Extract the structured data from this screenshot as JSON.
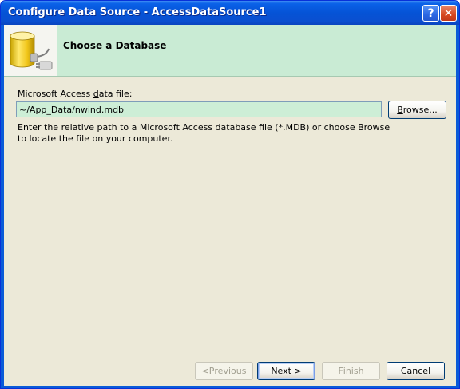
{
  "window": {
    "title": "Configure Data Source - AccessDataSource1",
    "help_glyph": "?",
    "close_glyph": "✕"
  },
  "header": {
    "title": "Choose a Database",
    "icon": "database-plug-icon"
  },
  "file": {
    "label_before": "Microsoft Access ",
    "label_mnemonic": "d",
    "label_after": "ata file:",
    "value": "~/App_Data/nwind.mdb",
    "browse_before": "",
    "browse_mnemonic": "B",
    "browse_after": "rowse..."
  },
  "help_text": "Enter the relative path to a Microsoft Access database file (*.MDB) or choose Browse to locate the file on your computer.",
  "buttons": {
    "previous_before": "< ",
    "previous_mnemonic": "P",
    "previous_after": "revious",
    "next_before": "",
    "next_mnemonic": "N",
    "next_after": "ext >",
    "finish_before": "",
    "finish_mnemonic": "F",
    "finish_after": "inish",
    "cancel": "Cancel"
  },
  "colors": {
    "titlebar": "#0553d6",
    "header_band": "#c9ebd4",
    "input_background": "#cdeed6",
    "dialog_background": "#ece9d8"
  }
}
